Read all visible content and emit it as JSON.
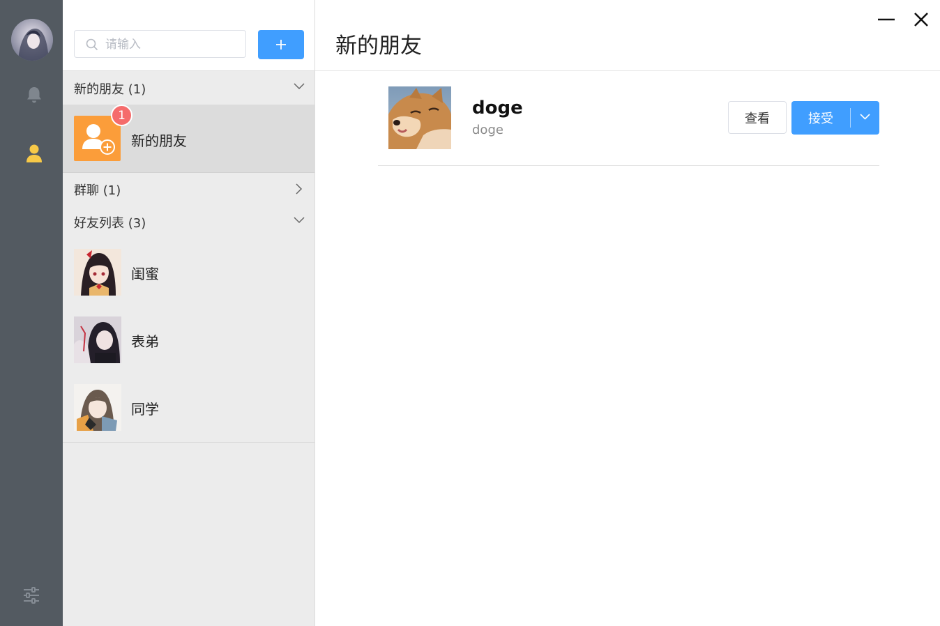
{
  "search": {
    "placeholder": "请输入"
  },
  "groups": {
    "new_friends": {
      "label": "新的朋友 (1)"
    },
    "group_chats": {
      "label": "群聊 (1)"
    },
    "friend_list": {
      "label": "好友列表 (3)"
    }
  },
  "new_friend_item": {
    "label": "新的朋友",
    "badge": "1"
  },
  "friends": [
    {
      "name": "闺蜜"
    },
    {
      "name": "表弟"
    },
    {
      "name": "同学"
    }
  ],
  "pane": {
    "title": "新的朋友"
  },
  "request": {
    "name": "doge",
    "subtitle": "doge",
    "view_label": "查看",
    "accept_label": "接受"
  },
  "colors": {
    "rail": "#535a61",
    "accent": "#409eff",
    "badge": "#f56c6c",
    "new_friend_icon": "#fb9d3a",
    "active_nav": "#f7c948"
  }
}
